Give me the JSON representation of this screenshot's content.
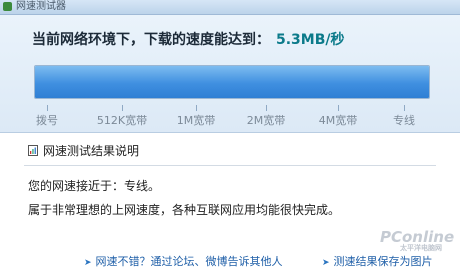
{
  "window": {
    "title": "网速测试器"
  },
  "headline": {
    "text": "当前网络环境下，下载的速度能达到：",
    "speed": "5.3MB/秒"
  },
  "speed_bar": {
    "fill_fraction": 1.0,
    "fill_color": "#3f8fe0",
    "scale_labels": [
      "拨号",
      "512K宽带",
      "1M宽带",
      "2M宽带",
      "4M宽带",
      "专线"
    ]
  },
  "result": {
    "title": "网速测试结果说明",
    "line1": "您的网速接近于：专线。",
    "line2": "属于非常理想的上网速度，各种互联网应用均能很快完成。"
  },
  "footer": {
    "share_link": "网速不错？通过论坛、微博告诉其他人",
    "save_link": "测速结果保存为图片"
  },
  "watermark": {
    "text": "PConline",
    "subtext": "太平洋电脑网"
  }
}
